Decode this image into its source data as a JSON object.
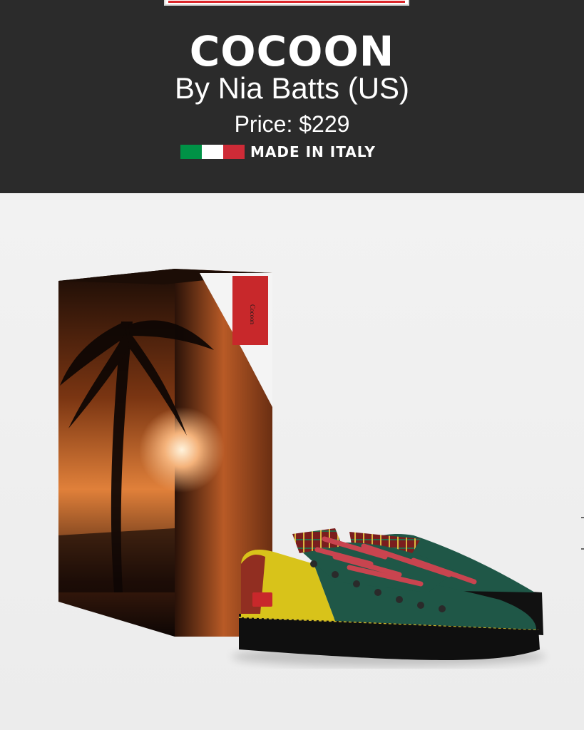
{
  "product": {
    "name": "COCOON",
    "designer": "By Nia Batts (US)",
    "price": "Price: $229",
    "origin": "MADE IN ITALY",
    "box_label": "Cocoon"
  },
  "icons": {
    "flag": "italy-flag-icon"
  },
  "colors": {
    "header_bg": "#2b2b2b",
    "flag_green": "#009246",
    "flag_white": "#ffffff",
    "flag_red": "#ce2b37",
    "accent_red": "#d9262a",
    "shoe_green": "#1f5747",
    "shoe_yellow": "#d8c31a",
    "lace_red": "#c9444f"
  }
}
